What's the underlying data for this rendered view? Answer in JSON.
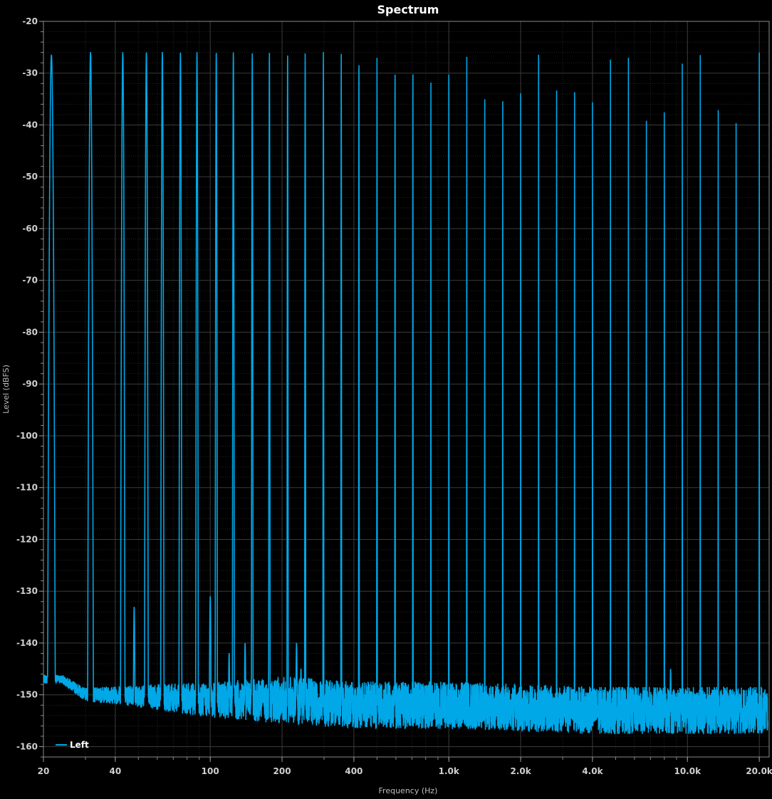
{
  "chart_data": {
    "type": "line",
    "title": "Spectrum",
    "xlabel": "Frequency (Hz)",
    "ylabel": "Level (dBFS)",
    "x_scale": "log",
    "xlim": [
      20,
      22000
    ],
    "ylim": [
      -162,
      -20
    ],
    "grid": true,
    "legend_position": "bottom-left",
    "x_ticks": [
      {
        "value": 20,
        "label": "20"
      },
      {
        "value": 40,
        "label": "40"
      },
      {
        "value": 100,
        "label": "100"
      },
      {
        "value": 200,
        "label": "200"
      },
      {
        "value": 400,
        "label": "400"
      },
      {
        "value": 1000,
        "label": "1.0k"
      },
      {
        "value": 2000,
        "label": "2.0k"
      },
      {
        "value": 4000,
        "label": "4.0k"
      },
      {
        "value": 10000,
        "label": "10.0k"
      },
      {
        "value": 20000,
        "label": "20.0k"
      }
    ],
    "y_ticks": [
      {
        "value": -20,
        "label": "-20"
      },
      {
        "value": -30,
        "label": "-30"
      },
      {
        "value": -40,
        "label": "-40"
      },
      {
        "value": -50,
        "label": "-50"
      },
      {
        "value": -60,
        "label": "-60"
      },
      {
        "value": -70,
        "label": "-70"
      },
      {
        "value": -80,
        "label": "-80"
      },
      {
        "value": -90,
        "label": "-90"
      },
      {
        "value": -100,
        "label": "-100"
      },
      {
        "value": -110,
        "label": "-110"
      },
      {
        "value": -120,
        "label": "-120"
      },
      {
        "value": -130,
        "label": "-130"
      },
      {
        "value": -140,
        "label": "-140"
      },
      {
        "value": -150,
        "label": "-150"
      },
      {
        "value": -160,
        "label": "-160"
      }
    ],
    "series": [
      {
        "name": "Left",
        "color": "#00a8e8",
        "peaks": [
          {
            "freq": 21.6,
            "level": -26.5
          },
          {
            "freq": 31.5,
            "level": -26
          },
          {
            "freq": 43,
            "level": -26
          },
          {
            "freq": 54,
            "level": -26
          },
          {
            "freq": 63,
            "level": -26
          },
          {
            "freq": 75,
            "level": -26
          },
          {
            "freq": 88,
            "level": -26
          },
          {
            "freq": 106,
            "level": -26
          },
          {
            "freq": 125,
            "level": -26
          },
          {
            "freq": 150,
            "level": -26
          },
          {
            "freq": 177,
            "level": -26
          },
          {
            "freq": 211,
            "level": -26
          },
          {
            "freq": 250,
            "level": -26
          },
          {
            "freq": 298,
            "level": -26
          },
          {
            "freq": 354,
            "level": -26
          },
          {
            "freq": 420,
            "level": -26
          },
          {
            "freq": 500,
            "level": -26
          },
          {
            "freq": 595,
            "level": -26
          },
          {
            "freq": 707,
            "level": -26
          },
          {
            "freq": 841,
            "level": -26
          },
          {
            "freq": 1000,
            "level": -26
          },
          {
            "freq": 1189,
            "level": -26
          },
          {
            "freq": 1414,
            "level": -26
          },
          {
            "freq": 1682,
            "level": -26
          },
          {
            "freq": 2000,
            "level": -26
          },
          {
            "freq": 2378,
            "level": -26
          },
          {
            "freq": 2828,
            "level": -26
          },
          {
            "freq": 3364,
            "level": -26
          },
          {
            "freq": 4000,
            "level": -26
          },
          {
            "freq": 4757,
            "level": -26
          },
          {
            "freq": 5657,
            "level": -26
          },
          {
            "freq": 6727,
            "level": -26
          },
          {
            "freq": 8000,
            "level": -26
          },
          {
            "freq": 9514,
            "level": -26
          },
          {
            "freq": 11314,
            "level": -26
          },
          {
            "freq": 13454,
            "level": -26
          },
          {
            "freq": 16000,
            "level": -26
          },
          {
            "freq": 20000,
            "level": -26
          }
        ],
        "noise_floor": [
          {
            "freq": 24,
            "level": -147
          },
          {
            "freq": 30,
            "level": -150
          },
          {
            "freq": 40,
            "level": -150
          },
          {
            "freq": 100,
            "level": -151
          },
          {
            "freq": 200,
            "level": -151
          },
          {
            "freq": 400,
            "level": -152
          },
          {
            "freq": 1000,
            "level": -152
          },
          {
            "freq": 4000,
            "level": -153
          },
          {
            "freq": 21000,
            "level": -153
          }
        ],
        "spurs": [
          {
            "freq": 48,
            "level": -133
          },
          {
            "freq": 100,
            "level": -131
          },
          {
            "freq": 120,
            "level": -142
          },
          {
            "freq": 140,
            "level": -140
          },
          {
            "freq": 230,
            "level": -140
          },
          {
            "freq": 240,
            "level": -145
          },
          {
            "freq": 8500,
            "level": -145
          }
        ]
      }
    ]
  }
}
